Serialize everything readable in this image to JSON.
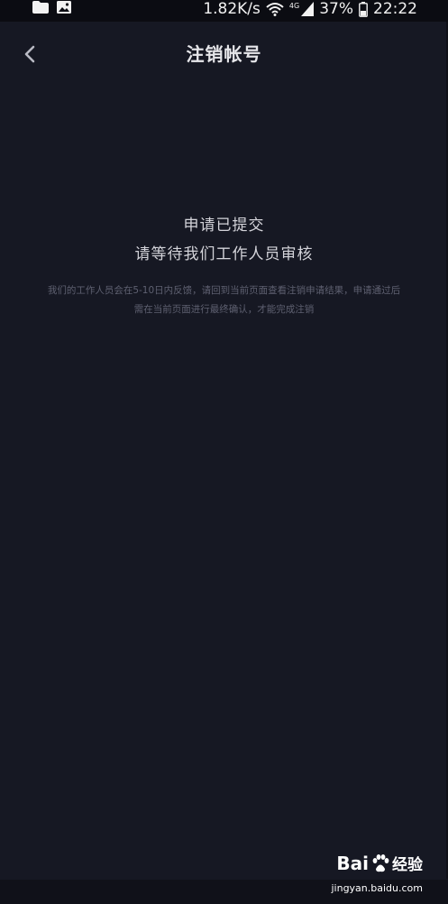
{
  "status_bar": {
    "network_speed": "1.82K/s",
    "network_type": "4G",
    "battery_percent": "37%",
    "time": "22:22",
    "icons": [
      "folder-icon",
      "image-icon",
      "wifi-icon",
      "signal-icon",
      "battery-icon"
    ]
  },
  "header": {
    "title": "注销帐号",
    "back_icon": "chevron-left-icon"
  },
  "main": {
    "headline_line1": "申请已提交",
    "headline_line2": "请等待我们工作人员审核",
    "description_line1": "我们的工作人员会在5-10日内反馈，请回到当前页面查看注销申请结果，申请通过后",
    "description_line2": "需在当前页面进行最终确认，才能完成注销"
  },
  "watermark": {
    "brand_prefix": "Bai",
    "brand_suffix": "经验",
    "url": "jingyan.baidu.com"
  },
  "colors": {
    "background": "#161823",
    "title_text": "#e6e6ea",
    "headline_text": "#d3d3d9",
    "description_text": "#5e6070"
  }
}
